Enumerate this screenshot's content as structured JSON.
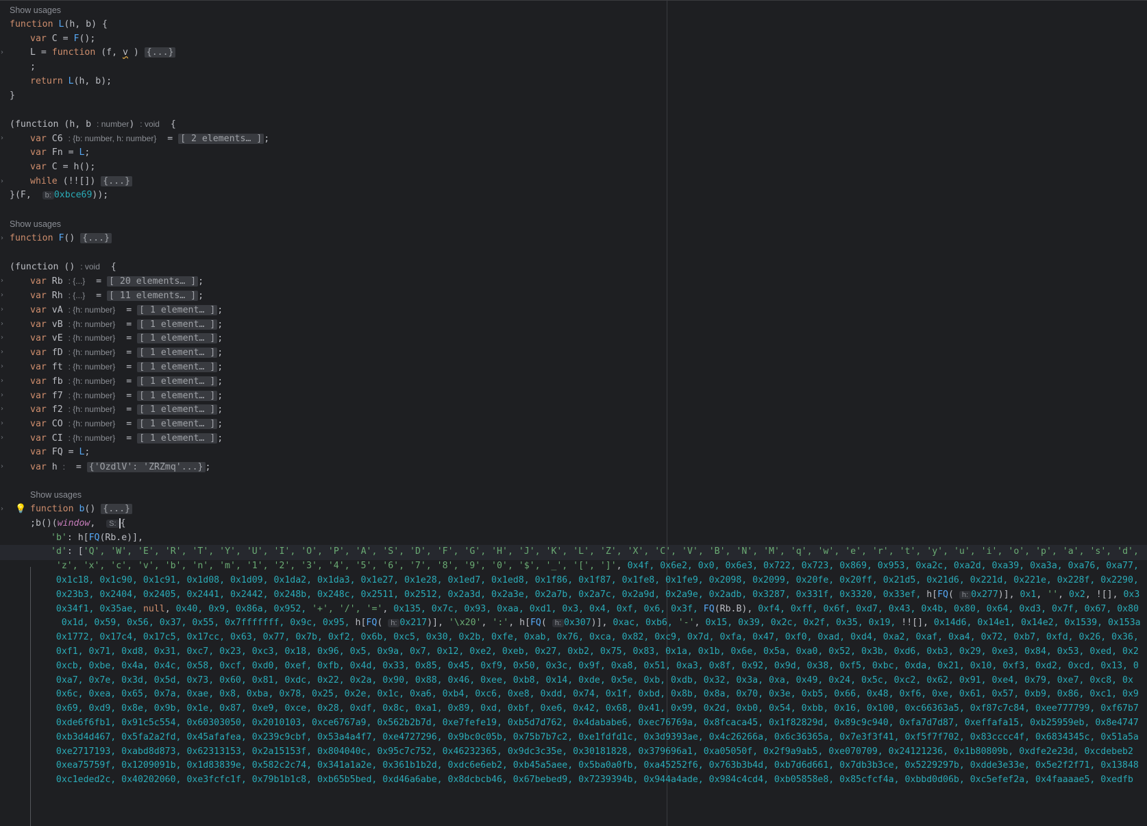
{
  "lines": [
    {
      "t": "usage",
      "text": "Show usages",
      "indent": 0
    },
    {
      "t": "code",
      "indent": 0,
      "fold": false,
      "spans": [
        [
          "k",
          "function "
        ],
        [
          "f",
          "L"
        ],
        [
          "",
          "(h, b) {"
        ]
      ]
    },
    {
      "t": "code",
      "indent": 1,
      "fold": false,
      "spans": [
        [
          "k",
          "var "
        ],
        [
          "",
          "C = "
        ],
        [
          "f",
          "F"
        ],
        [
          "",
          "();"
        ]
      ]
    },
    {
      "t": "code",
      "indent": 1,
      "fold": true,
      "spans": [
        [
          "",
          "L = "
        ],
        [
          "k",
          "function "
        ],
        [
          "",
          "(f, "
        ],
        [
          "d",
          "v"
        ],
        [
          "",
          " ) "
        ],
        [
          "fold",
          "{...}"
        ]
      ]
    },
    {
      "t": "code",
      "indent": 1,
      "fold": false,
      "spans": [
        [
          "",
          ";"
        ]
      ]
    },
    {
      "t": "code",
      "indent": 1,
      "fold": false,
      "spans": [
        [
          "k",
          "return "
        ],
        [
          "f",
          "L"
        ],
        [
          "",
          "(h, b);"
        ]
      ]
    },
    {
      "t": "code",
      "indent": 0,
      "fold": false,
      "spans": [
        [
          "",
          "}"
        ]
      ]
    },
    {
      "t": "blank"
    },
    {
      "t": "code",
      "indent": 0,
      "fold": false,
      "spans": [
        [
          "",
          "(function (h, b "
        ],
        [
          "hint",
          ": number"
        ],
        [
          "",
          ") "
        ],
        [
          "hint",
          ": void"
        ],
        [
          "",
          "  {"
        ]
      ]
    },
    {
      "t": "code",
      "indent": 1,
      "fold": true,
      "spans": [
        [
          "k",
          "var "
        ],
        [
          "",
          "C6 "
        ],
        [
          "hint",
          ": {b: number, h: number}"
        ],
        [
          "",
          "  = "
        ],
        [
          "fold",
          "[ 2 elements… ]"
        ],
        [
          "",
          ";"
        ]
      ]
    },
    {
      "t": "code",
      "indent": 1,
      "fold": false,
      "spans": [
        [
          "k",
          "var "
        ],
        [
          "",
          "Fn = "
        ],
        [
          "f",
          "L"
        ],
        [
          "",
          ";"
        ]
      ]
    },
    {
      "t": "code",
      "indent": 1,
      "fold": false,
      "spans": [
        [
          "k",
          "var "
        ],
        [
          "",
          "C = h();"
        ]
      ]
    },
    {
      "t": "code",
      "indent": 1,
      "fold": true,
      "spans": [
        [
          "k",
          "while "
        ],
        [
          "",
          "(!![]) "
        ],
        [
          "fold",
          "{...}"
        ]
      ]
    },
    {
      "t": "code",
      "indent": 0,
      "fold": false,
      "spans": [
        [
          "",
          "}(F,  "
        ],
        [
          "box",
          "b:"
        ],
        [
          "n",
          "0xbce69"
        ],
        [
          "",
          "));"
        ]
      ]
    },
    {
      "t": "blank"
    },
    {
      "t": "usage",
      "text": "Show usages",
      "indent": 0
    },
    {
      "t": "code",
      "indent": 0,
      "fold": true,
      "spans": [
        [
          "k",
          "function "
        ],
        [
          "f",
          "F"
        ],
        [
          "",
          "() "
        ],
        [
          "fold",
          "{...}"
        ]
      ]
    },
    {
      "t": "blank"
    },
    {
      "t": "code",
      "indent": 0,
      "fold": false,
      "spans": [
        [
          "",
          "(function () "
        ],
        [
          "hint",
          ": void"
        ],
        [
          "",
          "  {"
        ]
      ]
    },
    {
      "t": "code",
      "indent": 1,
      "fold": true,
      "spans": [
        [
          "k",
          "var "
        ],
        [
          "",
          "Rb "
        ],
        [
          "hint",
          ": {...}"
        ],
        [
          "",
          "  = "
        ],
        [
          "fold",
          "[ 20 elements… ]"
        ],
        [
          "",
          ";"
        ]
      ]
    },
    {
      "t": "code",
      "indent": 1,
      "fold": true,
      "spans": [
        [
          "k",
          "var "
        ],
        [
          "",
          "Rh "
        ],
        [
          "hint",
          ": {...}"
        ],
        [
          "",
          "  = "
        ],
        [
          "fold",
          "[ 11 elements… ]"
        ],
        [
          "",
          ";"
        ]
      ]
    },
    {
      "t": "code",
      "indent": 1,
      "fold": true,
      "spans": [
        [
          "k",
          "var "
        ],
        [
          "",
          "vA "
        ],
        [
          "hint",
          ": {h: number}"
        ],
        [
          "",
          "  = "
        ],
        [
          "fold",
          "[ 1 element… ]"
        ],
        [
          "",
          ";"
        ]
      ]
    },
    {
      "t": "code",
      "indent": 1,
      "fold": true,
      "spans": [
        [
          "k",
          "var "
        ],
        [
          "",
          "vB "
        ],
        [
          "hint",
          ": {h: number}"
        ],
        [
          "",
          "  = "
        ],
        [
          "fold",
          "[ 1 element… ]"
        ],
        [
          "",
          ";"
        ]
      ]
    },
    {
      "t": "code",
      "indent": 1,
      "fold": true,
      "spans": [
        [
          "k",
          "var "
        ],
        [
          "",
          "vE "
        ],
        [
          "hint",
          ": {h: number}"
        ],
        [
          "",
          "  = "
        ],
        [
          "fold",
          "[ 1 element… ]"
        ],
        [
          "",
          ";"
        ]
      ]
    },
    {
      "t": "code",
      "indent": 1,
      "fold": true,
      "spans": [
        [
          "k",
          "var "
        ],
        [
          "",
          "fD "
        ],
        [
          "hint",
          ": {h: number}"
        ],
        [
          "",
          "  = "
        ],
        [
          "fold",
          "[ 1 element… ]"
        ],
        [
          "",
          ";"
        ]
      ]
    },
    {
      "t": "code",
      "indent": 1,
      "fold": true,
      "spans": [
        [
          "k",
          "var "
        ],
        [
          "",
          "ft "
        ],
        [
          "hint",
          ": {h: number}"
        ],
        [
          "",
          "  = "
        ],
        [
          "fold",
          "[ 1 element… ]"
        ],
        [
          "",
          ";"
        ]
      ]
    },
    {
      "t": "code",
      "indent": 1,
      "fold": true,
      "spans": [
        [
          "k",
          "var "
        ],
        [
          "",
          "fb "
        ],
        [
          "hint",
          ": {h: number}"
        ],
        [
          "",
          "  = "
        ],
        [
          "fold",
          "[ 1 element… ]"
        ],
        [
          "",
          ";"
        ]
      ]
    },
    {
      "t": "code",
      "indent": 1,
      "fold": true,
      "spans": [
        [
          "k",
          "var "
        ],
        [
          "",
          "f7 "
        ],
        [
          "hint",
          ": {h: number}"
        ],
        [
          "",
          "  = "
        ],
        [
          "fold",
          "[ 1 element… ]"
        ],
        [
          "",
          ";"
        ]
      ]
    },
    {
      "t": "code",
      "indent": 1,
      "fold": true,
      "spans": [
        [
          "k",
          "var "
        ],
        [
          "",
          "f2 "
        ],
        [
          "hint",
          ": {h: number}"
        ],
        [
          "",
          "  = "
        ],
        [
          "fold",
          "[ 1 element… ]"
        ],
        [
          "",
          ";"
        ]
      ]
    },
    {
      "t": "code",
      "indent": 1,
      "fold": true,
      "spans": [
        [
          "k",
          "var "
        ],
        [
          "",
          "CO "
        ],
        [
          "hint",
          ": {h: number}"
        ],
        [
          "",
          "  = "
        ],
        [
          "fold",
          "[ 1 element… ]"
        ],
        [
          "",
          ";"
        ]
      ]
    },
    {
      "t": "code",
      "indent": 1,
      "fold": true,
      "spans": [
        [
          "k",
          "var "
        ],
        [
          "",
          "CI "
        ],
        [
          "hint",
          ": {h: number}"
        ],
        [
          "",
          "  = "
        ],
        [
          "fold",
          "[ 1 element… ]"
        ],
        [
          "",
          ";"
        ]
      ]
    },
    {
      "t": "code",
      "indent": 1,
      "fold": false,
      "spans": [
        [
          "k",
          "var "
        ],
        [
          "",
          "FQ = "
        ],
        [
          "f",
          "L"
        ],
        [
          "",
          ";"
        ]
      ]
    },
    {
      "t": "code",
      "indent": 1,
      "fold": true,
      "spans": [
        [
          "k",
          "var "
        ],
        [
          "",
          "h "
        ],
        [
          "hint",
          ":"
        ],
        [
          "",
          "  = "
        ],
        [
          "fold",
          "{'OzdlV': 'ZRZmq'...}"
        ],
        [
          "",
          ";"
        ]
      ]
    },
    {
      "t": "blank"
    },
    {
      "t": "usage",
      "text": "Show usages",
      "indent": 1
    },
    {
      "t": "code",
      "indent": 1,
      "fold": true,
      "bulb": true,
      "spans": [
        [
          "k",
          "function "
        ],
        [
          "f",
          "b"
        ],
        [
          "",
          "() "
        ],
        [
          "fold",
          "{...}"
        ]
      ]
    },
    {
      "t": "code",
      "indent": 1,
      "fold": false,
      "spans": [
        [
          "",
          ";b()("
        ],
        [
          "i",
          "window"
        ],
        [
          "",
          ",  "
        ],
        [
          "box",
          "S:"
        ],
        [
          "caret",
          "{"
        ]
      ]
    },
    {
      "t": "code",
      "indent": 2,
      "fold": false,
      "spans": [
        [
          "s",
          "'b'"
        ],
        [
          "",
          ": h["
        ],
        [
          "f",
          "FQ"
        ],
        [
          "",
          "(Rb.e)],"
        ]
      ]
    },
    {
      "t": "code",
      "indent": 2,
      "fold": false,
      "spans": [
        [
          "s",
          "'d'"
        ],
        [
          "",
          ": ["
        ],
        [
          "s",
          "'Q', 'W', 'E', 'R', 'T', 'Y', 'U', 'I', 'O', 'P', 'A', 'S', 'D', 'F', 'G', 'H', 'J', 'K', 'L', 'Z', 'X', 'C', 'V', 'B', 'N', 'M', 'q', 'w', 'e', 'r', 't', 'y', 'u', 'i', 'o', 'p', 'a', 's', 'd',"
        ]
      ]
    },
    {
      "t": "code",
      "indent": 2,
      "pad": 1,
      "fold": false,
      "spans": [
        [
          "s",
          "'z', 'x', 'c', 'v', 'b', 'n', 'm', '1', '2', '3', '4', '5', '6', '7', '8', '9', '0', '$', '_', '[', ']'"
        ],
        [
          "",
          ", "
        ],
        [
          "n",
          "0x4f, 0x6e2, 0x0, 0x6e3, 0x722, 0x723, 0x869, 0x953, 0xa2c, 0xa2d, 0xa39, 0xa3a, 0xa76, 0xa77,"
        ]
      ]
    },
    {
      "t": "code",
      "indent": 2,
      "pad": 1,
      "fold": false,
      "spans": [
        [
          "n",
          "0x1c18, 0x1c90, 0x1c91, 0x1d08, 0x1d09, 0x1da2, 0x1da3, 0x1e27, 0x1e28, 0x1ed7, 0x1ed8, 0x1f86, 0x1f87, 0x1fe8, 0x1fe9, 0x2098, 0x2099, 0x20fe, 0x20ff, 0x21d5, 0x21d6, 0x221d, 0x221e, 0x228f, 0x2290,"
        ]
      ]
    },
    {
      "t": "code",
      "indent": 2,
      "pad": 1,
      "fold": false,
      "spans": [
        [
          "n",
          "0x23b3, 0x2404, 0x2405, 0x2441, 0x2442, 0x248b, 0x248c, 0x2511, 0x2512, 0x2a3d, 0x2a3e, 0x2a7b, 0x2a7c, 0x2a9d, 0x2a9e, 0x2adb, 0x3287, 0x331f, 0x3320, 0x33ef,"
        ],
        [
          "",
          " h["
        ],
        [
          "f",
          "FQ"
        ],
        [
          "",
          "( "
        ],
        [
          "box",
          "h:"
        ],
        [
          "n",
          "0x277"
        ],
        [
          "",
          ")], "
        ],
        [
          "n",
          "0x1"
        ],
        [
          "",
          ", "
        ],
        [
          "s",
          "''"
        ],
        [
          "",
          ", "
        ],
        [
          "n",
          "0x2"
        ],
        [
          "",
          ", ![], "
        ],
        [
          "n",
          "0x3"
        ]
      ]
    },
    {
      "t": "code",
      "indent": 2,
      "pad": 1,
      "fold": false,
      "spans": [
        [
          "n",
          "0x34f1, 0x35ae,"
        ],
        [
          "",
          " "
        ],
        [
          "k",
          "null"
        ],
        [
          "",
          ", "
        ],
        [
          "n",
          "0x40, 0x9, 0x86a, 0x952,"
        ],
        [
          "",
          " "
        ],
        [
          "s",
          "'+', '/', '='"
        ],
        [
          "",
          ", "
        ],
        [
          "n",
          "0x135, 0x7c, 0x93, 0xaa, 0xd1, 0x3, 0x4, 0xf, 0x6, 0x3f,"
        ],
        [
          "",
          " "
        ],
        [
          "f",
          "FQ"
        ],
        [
          "",
          "(Rb.B), "
        ],
        [
          "n",
          "0xf4, 0xff, 0x6f, 0xd7, 0x43, 0x4b, 0x80, 0x64, 0xd3, 0x7f, 0x67, 0x80"
        ]
      ]
    },
    {
      "t": "code",
      "indent": 2,
      "pad": 2,
      "fold": false,
      "spans": [
        [
          "n",
          "0x1d, 0x59, 0x56, 0x37, 0x55, 0x7fffffff, 0x9c, 0x95,"
        ],
        [
          "",
          " h["
        ],
        [
          "f",
          "FQ"
        ],
        [
          "",
          "( "
        ],
        [
          "box",
          "h:"
        ],
        [
          "n",
          "0x217"
        ],
        [
          "",
          ")], "
        ],
        [
          "s",
          "'\\x20'"
        ],
        [
          "",
          ", "
        ],
        [
          "s",
          "':'"
        ],
        [
          "",
          ", h["
        ],
        [
          "f",
          "FQ"
        ],
        [
          "",
          "( "
        ],
        [
          "box",
          "h:"
        ],
        [
          "n",
          "0x307"
        ],
        [
          "",
          ")], "
        ],
        [
          "n",
          "0xac, 0xb6,"
        ],
        [
          "",
          " "
        ],
        [
          "s",
          "'-'"
        ],
        [
          "",
          ", "
        ],
        [
          "n",
          "0x15, 0x39, 0x2c, 0x2f, 0x35, 0x19,"
        ],
        [
          "",
          " !![], "
        ],
        [
          "n",
          "0x14d6, 0x14e1, 0x14e2, 0x1539, 0x153a"
        ]
      ]
    },
    {
      "t": "code",
      "indent": 2,
      "pad": 1,
      "fold": false,
      "spans": [
        [
          "n",
          "0x1772, 0x17c4, 0x17c5, 0x17cc, 0x63, 0x77, 0x7b, 0xf2, 0x6b, 0xc5, 0x30, 0x2b, 0xfe, 0xab, 0x76, 0xca, 0x82, 0xc9, 0x7d, 0xfa, 0x47, 0xf0, 0xad, 0xd4, 0xa2, 0xaf, 0xa4, 0x72, 0xb7, 0xfd, 0x26, 0x36,"
        ]
      ]
    },
    {
      "t": "code",
      "indent": 2,
      "pad": 1,
      "fold": false,
      "spans": [
        [
          "n",
          "0xf1, 0x71, 0xd8, 0x31, 0xc7, 0x23, 0xc3, 0x18, 0x96, 0x5, 0x9a, 0x7, 0x12, 0xe2, 0xeb, 0x27, 0xb2, 0x75, 0x83, 0x1a, 0x1b, 0x6e, 0x5a, 0xa0, 0x52, 0x3b, 0xd6, 0xb3, 0x29, 0xe3, 0x84, 0x53, 0xed, 0x2"
        ]
      ]
    },
    {
      "t": "code",
      "indent": 2,
      "pad": 1,
      "fold": false,
      "spans": [
        [
          "n",
          "0xcb, 0xbe, 0x4a, 0x4c, 0x58, 0xcf, 0xd0, 0xef, 0xfb, 0x4d, 0x33, 0x85, 0x45, 0xf9, 0x50, 0x3c, 0x9f, 0xa8, 0x51, 0xa3, 0x8f, 0x92, 0x9d, 0x38, 0xf5, 0xbc, 0xda, 0x21, 0x10, 0xf3, 0xd2, 0xcd, 0x13, 0"
        ]
      ]
    },
    {
      "t": "code",
      "indent": 2,
      "pad": 1,
      "fold": false,
      "spans": [
        [
          "n",
          "0xa7, 0x7e, 0x3d, 0x5d, 0x73, 0x60, 0x81, 0xdc, 0x22, 0x2a, 0x90, 0x88, 0x46, 0xee, 0xb8, 0x14, 0xde, 0x5e, 0xb, 0xdb, 0x32, 0x3a, 0xa, 0x49, 0x24, 0x5c, 0xc2, 0x62, 0x91, 0xe4, 0x79, 0xe7, 0xc8, 0x"
        ]
      ]
    },
    {
      "t": "code",
      "indent": 2,
      "pad": 1,
      "fold": false,
      "spans": [
        [
          "n",
          "0x6c, 0xea, 0x65, 0x7a, 0xae, 0x8, 0xba, 0x78, 0x25, 0x2e, 0x1c, 0xa6, 0xb4, 0xc6, 0xe8, 0xdd, 0x74, 0x1f, 0xbd, 0x8b, 0x8a, 0x70, 0x3e, 0xb5, 0x66, 0x48, 0xf6, 0xe, 0x61, 0x57, 0xb9, 0x86, 0xc1, 0x9"
        ]
      ]
    },
    {
      "t": "code",
      "indent": 2,
      "pad": 1,
      "fold": false,
      "spans": [
        [
          "n",
          "0x69, 0xd9, 0x8e, 0x9b, 0x1e, 0x87, 0xe9, 0xce, 0x28, 0xdf, 0x8c, 0xa1, 0x89, 0xd, 0xbf, 0xe6, 0x42, 0x68, 0x41, 0x99, 0x2d, 0xb0, 0x54, 0xbb, 0x16, 0x100, 0xc66363a5, 0xf87c7c84, 0xee777799, 0xf67b7"
        ]
      ]
    },
    {
      "t": "code",
      "indent": 2,
      "pad": 1,
      "fold": false,
      "spans": [
        [
          "n",
          "0xde6f6fb1, 0x91c5c554, 0x60303050, 0x2010103, 0xce6767a9, 0x562b2b7d, 0xe7fefe19, 0xb5d7d762, 0x4dababe6, 0xec76769a, 0x8fcaca45, 0x1f82829d, 0x89c9c940, 0xfa7d7d87, 0xeffafa15, 0xb25959eb, 0x8e4747"
        ]
      ]
    },
    {
      "t": "code",
      "indent": 2,
      "pad": 1,
      "fold": false,
      "spans": [
        [
          "n",
          "0xb3d4d467, 0x5fa2a2fd, 0x45afafea, 0x239c9cbf, 0x53a4a4f7, 0xe4727296, 0x9bc0c05b, 0x75b7b7c2, 0xe1fdfd1c, 0x3d9393ae, 0x4c26266a, 0x6c36365a, 0x7e3f3f41, 0xf5f7f702, 0x83cccc4f, 0x6834345c, 0x51a5a"
        ]
      ]
    },
    {
      "t": "code",
      "indent": 2,
      "pad": 1,
      "fold": false,
      "spans": [
        [
          "n",
          "0xe2717193, 0xabd8d873, 0x62313153, 0x2a15153f, 0x804040c, 0x95c7c752, 0x46232365, 0x9dc3c35e, 0x30181828, 0x379696a1, 0xa05050f, 0x2f9a9ab5, 0xe070709, 0x24121236, 0x1b80809b, 0xdfe2e23d, 0xcdebeb2"
        ]
      ]
    },
    {
      "t": "code",
      "indent": 2,
      "pad": 1,
      "fold": false,
      "spans": [
        [
          "n",
          "0xea75759f, 0x1209091b, 0x1d83839e, 0x582c2c74, 0x341a1a2e, 0x361b1b2d, 0xdc6e6eb2, 0xb45a5aee, 0x5ba0a0fb, 0xa45252f6, 0x763b3b4d, 0xb7d6d661, 0x7db3b3ce, 0x5229297b, 0xdde3e33e, 0x5e2f2f71, 0x13848"
        ]
      ]
    },
    {
      "t": "code",
      "indent": 2,
      "pad": 1,
      "fold": false,
      "spans": [
        [
          "n",
          "0xc1eded2c, 0x40202060, 0xe3fcfc1f, 0x79b1b1c8, 0xb65b5bed, 0xd46a6abe, 0x8dcbcb46, 0x67bebed9, 0x7239394b, 0x944a4ade, 0x984c4cd4, 0xb05858e8, 0x85cfcf4a, 0xbbd0d06b, 0xc5efef2a, 0x4faaaae5, 0xedfb"
        ]
      ]
    }
  ]
}
